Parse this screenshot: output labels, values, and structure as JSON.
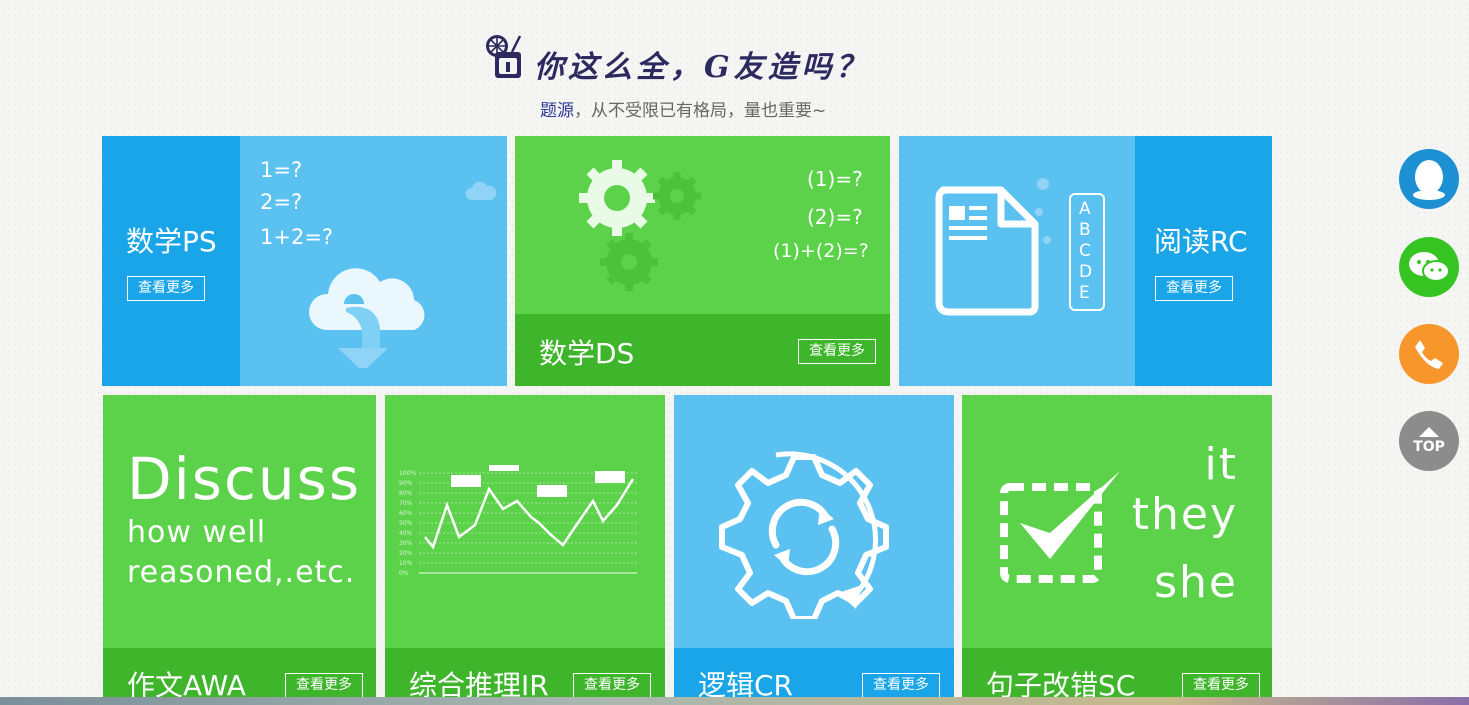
{
  "header": {
    "title": "你这么全，G友造吗？",
    "subtitle_highlight": "题源",
    "subtitle_rest": "，从不受限已有格局，量也重要~"
  },
  "tiles": {
    "ps": {
      "title": "数学PS",
      "more": "查看更多",
      "q1": "1=?",
      "q2": "2=?",
      "q3": "1+2=?"
    },
    "ds": {
      "title": "数学DS",
      "more": "查看更多",
      "q1": "(1)=?",
      "q2": "(2)=?",
      "q3": "(1)+(2)=?"
    },
    "rc": {
      "title": "阅读RC",
      "more": "查看更多",
      "letters": [
        "A",
        "B",
        "C",
        "D",
        "E"
      ]
    },
    "awa": {
      "title": "作文AWA",
      "more": "查看更多",
      "line1": "Discuss",
      "line2": "how well",
      "line3": "reasoned,.etc."
    },
    "ir": {
      "title": "综合推理IR",
      "more": "查看更多",
      "chart_labels": [
        "100%",
        "90%",
        "80%",
        "70%",
        "60%",
        "50%",
        "40%",
        "30%",
        "20%",
        "10%",
        "0%"
      ]
    },
    "cr": {
      "title": "逻辑CR",
      "more": "查看更多"
    },
    "sc": {
      "title": "句子改错SC",
      "more": "查看更多",
      "w1": "it",
      "w2": "they",
      "w3": "she"
    }
  },
  "side": {
    "top_label": "TOP"
  },
  "colors": {
    "blue_dark": "#1aa5e8",
    "blue_light": "#5bc1f1",
    "green": "#5cd24b",
    "green_dark": "#3fb52c"
  },
  "icons": [
    "qq-icon",
    "wechat-icon",
    "phone-icon",
    "top-arrow-icon"
  ]
}
